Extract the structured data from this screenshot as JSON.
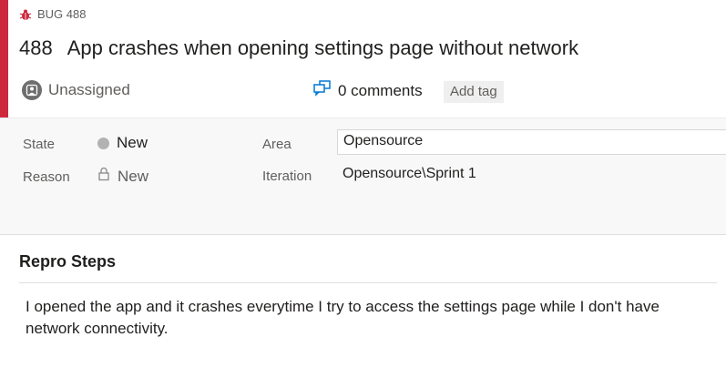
{
  "work_item": {
    "type_label": "BUG 488",
    "id": "488",
    "title": "App crashes when opening settings page without network",
    "accent_color": "#cc293d"
  },
  "meta": {
    "assignee": "Unassigned",
    "comments": "0 comments",
    "add_tag": "Add tag"
  },
  "fields": {
    "state_label": "State",
    "state_value": "New",
    "reason_label": "Reason",
    "reason_value": "New",
    "area_label": "Area",
    "area_value": "Opensource",
    "iteration_label": "Iteration",
    "iteration_value": "Opensource\\Sprint 1"
  },
  "repro": {
    "heading": "Repro Steps",
    "text": "I opened the app and it crashes everytime I try to access the settings page while I don't have network connectivity."
  },
  "icons": {
    "bug": "bug-icon",
    "avatar": "person-avatar-icon",
    "comments": "comments-icon",
    "lock": "lock-icon",
    "state": "state-dot-icon"
  }
}
